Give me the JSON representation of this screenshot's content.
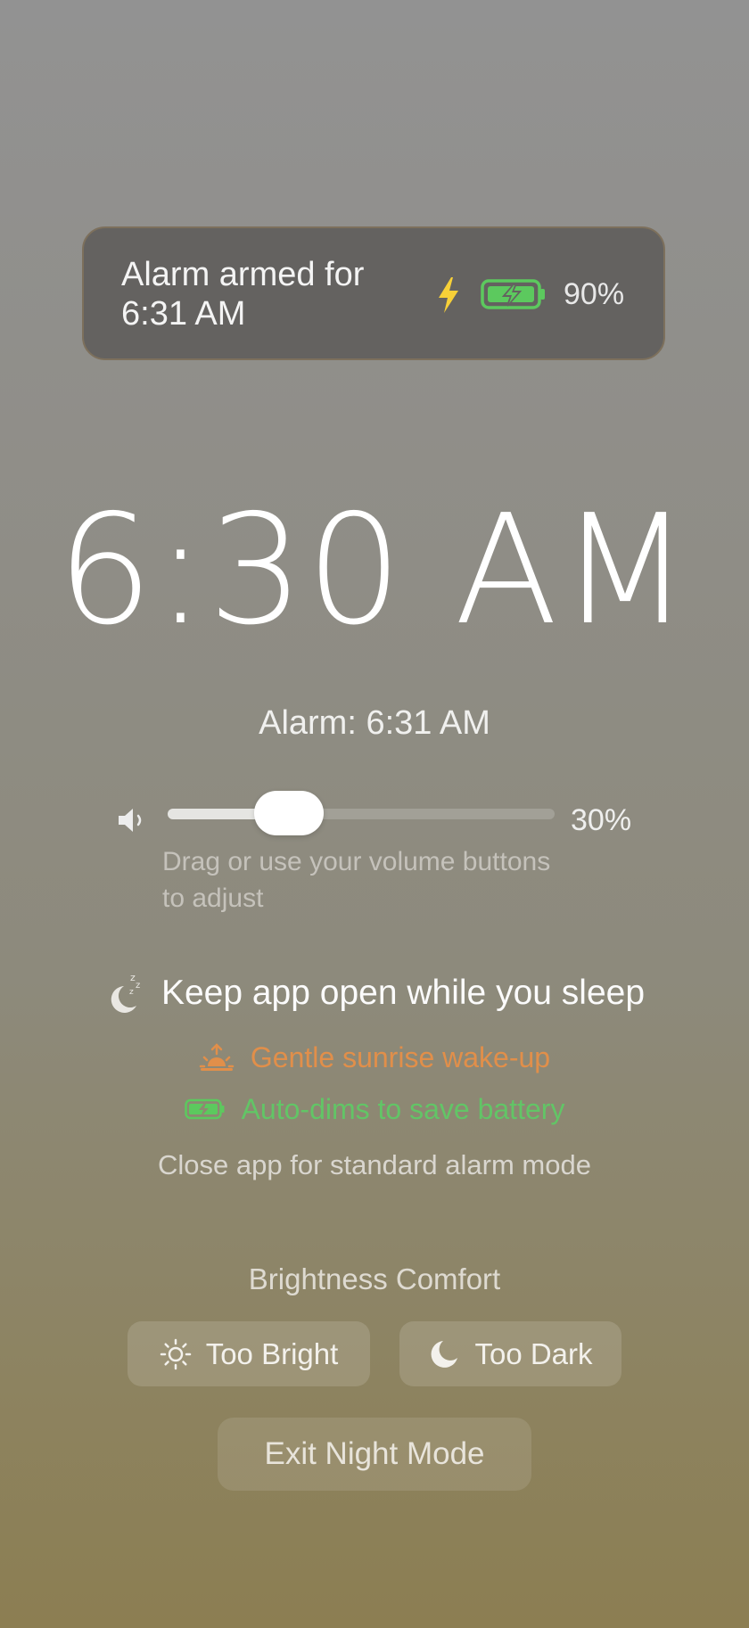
{
  "status_card": {
    "alarm_line1": "Alarm armed for",
    "alarm_line2": "6:31 AM",
    "battery_percent": "90%",
    "charging": true
  },
  "clock": {
    "time": "6:30 AM"
  },
  "alarm_label": "Alarm: 6:31 AM",
  "volume": {
    "level": 0.3,
    "percent_label": "30%",
    "hint_line1": "Drag or use your volume buttons",
    "hint_line2": "to adjust"
  },
  "sleep": {
    "title": "Keep app open while you sleep",
    "feature_sunrise": "Gentle sunrise wake-up",
    "feature_battery": "Auto-dims to save battery",
    "close_note": "Close app for standard alarm mode"
  },
  "brightness": {
    "label": "Brightness Comfort",
    "too_bright": "Too Bright",
    "too_dark": "Too Dark"
  },
  "exit_button": "Exit Night Mode",
  "colors": {
    "charging_bolt": "#f7d038",
    "battery_green": "#5cc95e",
    "sunrise_orange": "#e18f4a"
  },
  "icons": [
    "bolt-icon",
    "battery-charging-icon",
    "speaker-icon",
    "moon-zzz-icon",
    "sunrise-icon",
    "sun-icon",
    "moon-icon"
  ]
}
